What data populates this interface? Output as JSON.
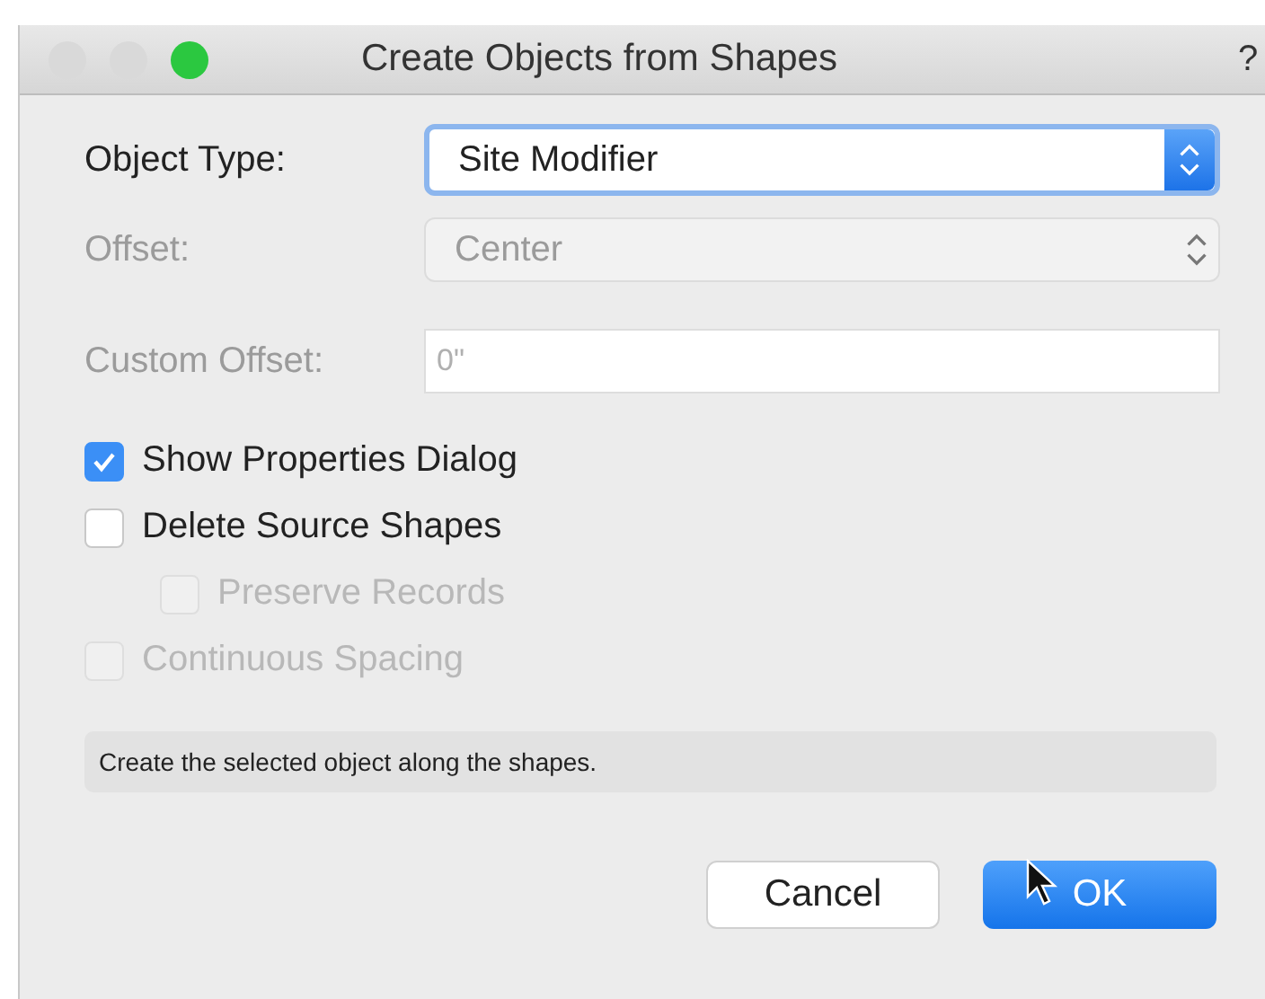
{
  "window": {
    "title": "Create Objects from Shapes",
    "help": "?",
    "controls": [
      {
        "color": "#d9d9d9"
      },
      {
        "color": "#d9d9d9"
      },
      {
        "color": "#2bc840"
      }
    ]
  },
  "fields": [
    {
      "kind": "select",
      "label": "Object Type:",
      "value": "Site Modifier",
      "disabled": false,
      "focused": true
    },
    {
      "kind": "select",
      "label": "Offset:",
      "value": "Center",
      "disabled": true,
      "focused": false
    },
    {
      "kind": "text",
      "label": "Custom Offset:",
      "placeholder": "0\"",
      "disabled": true
    }
  ],
  "checkboxes": [
    {
      "label": "Show Properties Dialog",
      "checked": true,
      "disabled": false
    },
    {
      "label": "Delete Source Shapes",
      "checked": false,
      "disabled": false,
      "children": [
        {
          "label": "Preserve Records",
          "checked": false,
          "disabled": true
        }
      ]
    },
    {
      "label": "Continuous Spacing",
      "checked": false,
      "disabled": true
    }
  ],
  "hint": "Create the selected object along the shapes.",
  "buttons": [
    {
      "label": "Cancel",
      "default": false
    },
    {
      "label": "OK",
      "default": true
    }
  ]
}
